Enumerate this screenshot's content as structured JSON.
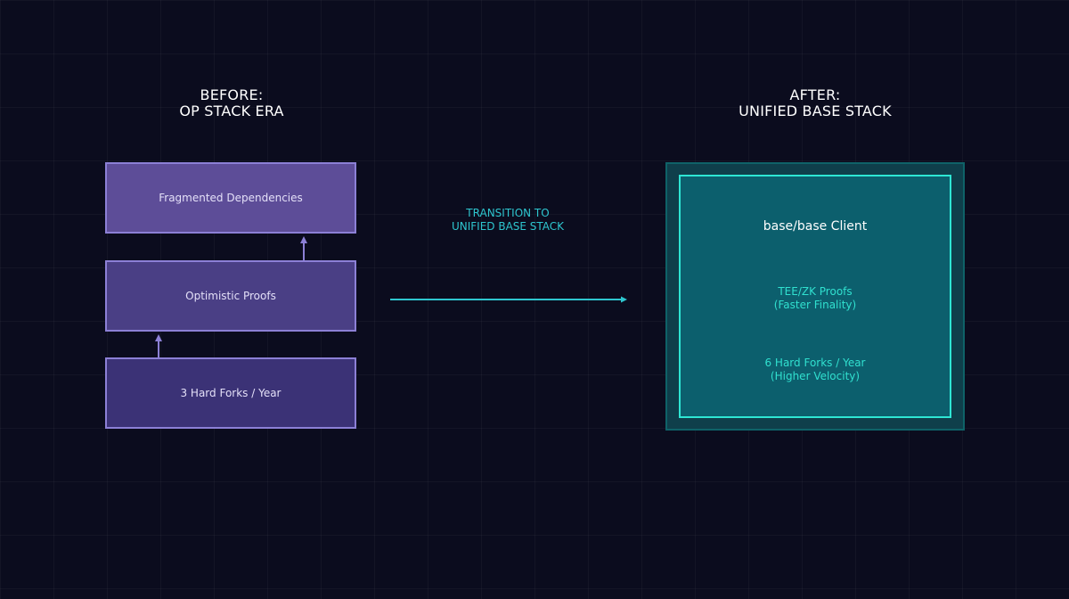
{
  "before": {
    "heading_line1": "BEFORE:",
    "heading_line2": "OP STACK ERA",
    "boxes": [
      {
        "label": "Fragmented Dependencies"
      },
      {
        "label": "Optimistic Proofs"
      },
      {
        "label": "3 Hard Forks / Year"
      }
    ]
  },
  "transition": {
    "line1": "TRANSITION TO",
    "line2": "UNIFIED BASE STACK"
  },
  "after": {
    "heading_line1": "AFTER:",
    "heading_line2": "UNIFIED BASE STACK",
    "client": "base/base Client",
    "proofs_line1": "TEE/ZK Proofs",
    "proofs_line2": "(Faster Finality)",
    "forks_line1": "6 Hard Forks / Year",
    "forks_line2": "(Higher Velocity)"
  },
  "colors": {
    "background": "#0b0c1e",
    "before_accent": "#8c80d6",
    "after_accent": "#2ee6d4",
    "transition_text": "#2ec6cf"
  }
}
